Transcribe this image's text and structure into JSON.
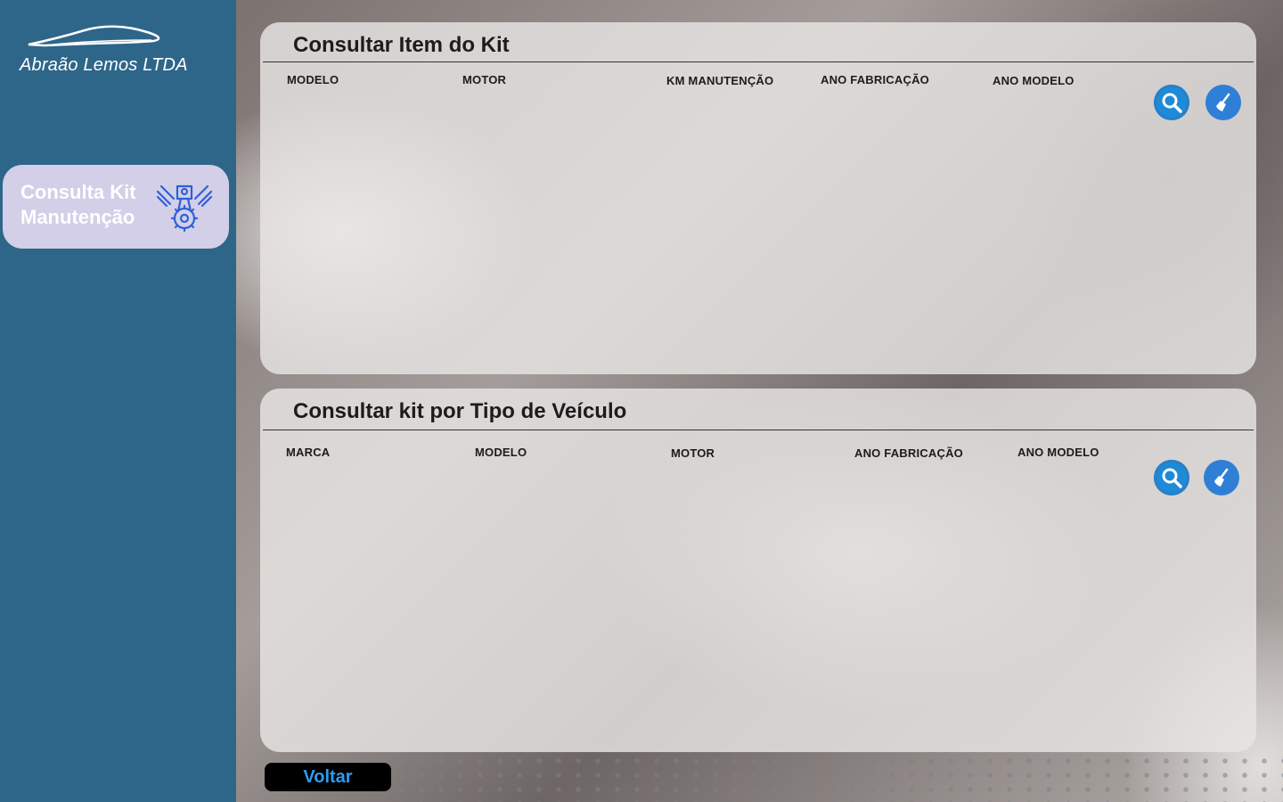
{
  "app": {
    "brand_name": "Abraão Lemos LTDA"
  },
  "sidebar": {
    "items": [
      {
        "label": "Consulta Kit\nManutenção",
        "icon": "engine-icon",
        "active": true
      }
    ]
  },
  "panels": {
    "item_kit": {
      "title": "Consultar Item do Kit",
      "columns": [
        "MODELO",
        "MOTOR",
        "KM MANUTENÇÃO",
        "ANO FABRICAÇÃO",
        "ANO MODELO"
      ],
      "search_icon": "search-icon",
      "clear_icon": "broom-icon"
    },
    "kit_vehicle": {
      "title": "Consultar kit por Tipo de Veículo",
      "columns": [
        "MARCA",
        "MODELO",
        "MOTOR",
        "ANO FABRICAÇÃO",
        "ANO MODELO"
      ],
      "search_icon": "search-icon",
      "clear_icon": "broom-icon"
    }
  },
  "footer": {
    "back_label": "Voltar"
  },
  "colors": {
    "sidebar": "#2e6689",
    "nav_active": "#d3cfe8",
    "accent_blue": "#1d8bd8",
    "back_text": "#2d9cf0"
  }
}
